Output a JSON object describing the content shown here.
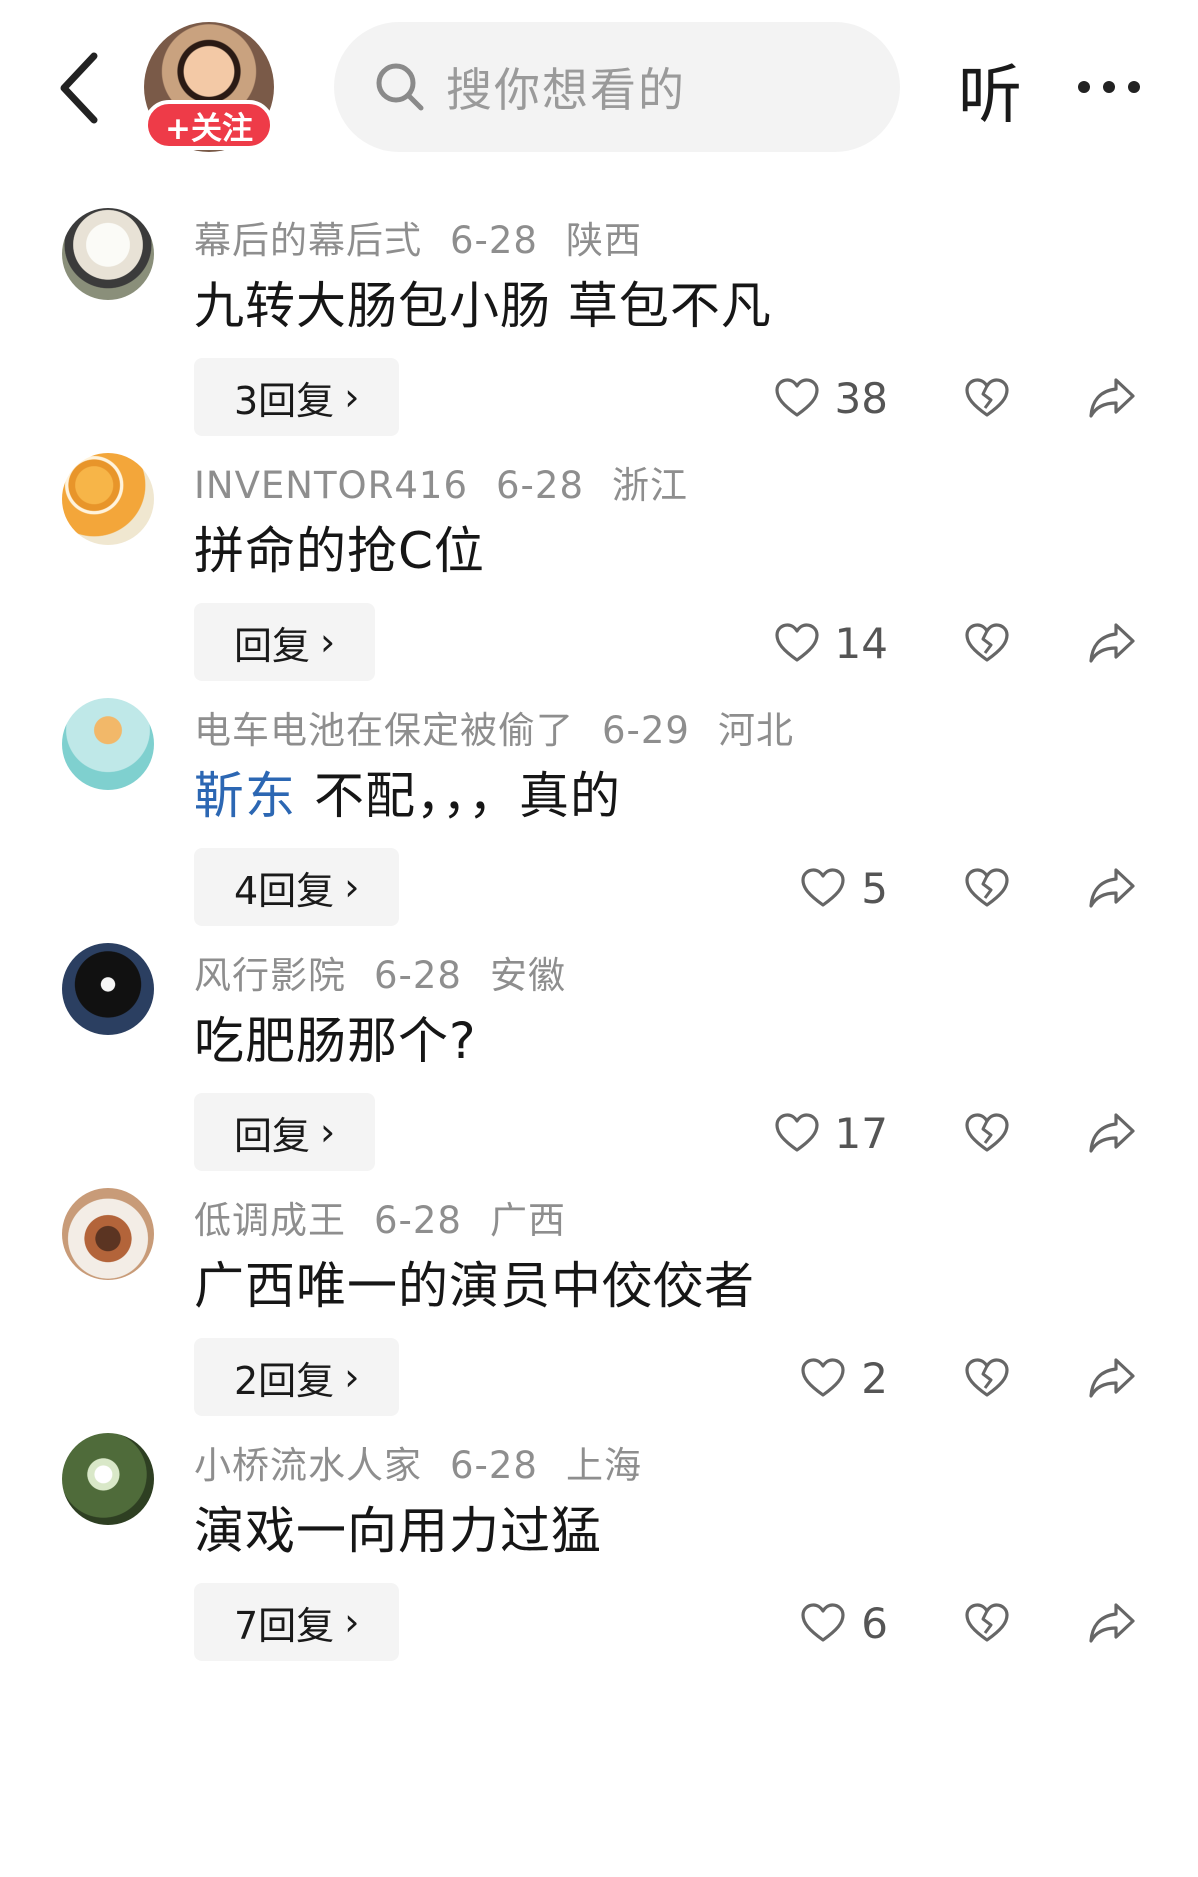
{
  "header": {
    "follow_label": "+关注",
    "search_placeholder": "搜你想看的",
    "listen_label": "听"
  },
  "comments": [
    {
      "user": "幕后的幕后弍",
      "date": "6-28",
      "region": "陕西",
      "text": "九转大肠包小肠 草包不凡",
      "mention": "",
      "reply_label": "3回复",
      "likes": "38",
      "avatar": "dog-avatar"
    },
    {
      "user": "INVENTOR416",
      "date": "6-28",
      "region": "浙江",
      "text": "拼命的抢C位",
      "mention": "",
      "reply_label": "回复",
      "likes": "14",
      "avatar": "loquat-avatar"
    },
    {
      "user": "电车电池在保定被偷了",
      "date": "6-29",
      "region": "河北",
      "text": "不配，，，真的",
      "mention": "靳东",
      "reply_label": "4回复",
      "likes": "5",
      "avatar": "cartoon-cat-avatar"
    },
    {
      "user": "风行影院",
      "date": "6-28",
      "region": "安徽",
      "text": "吃肥肠那个?",
      "mention": "",
      "reply_label": "回复",
      "likes": "17",
      "avatar": "hooded-figure-avatar"
    },
    {
      "user": "低调成王",
      "date": "6-28",
      "region": "广西",
      "text": "广西唯一的演员中佼佼者",
      "mention": "",
      "reply_label": "2回复",
      "likes": "2",
      "avatar": "food-bowl-avatar"
    },
    {
      "user": "小桥流水人家",
      "date": "6-28",
      "region": "上海",
      "text": "演戏一向用力过猛",
      "mention": "",
      "reply_label": "7回复",
      "likes": "6",
      "avatar": "flowers-avatar"
    }
  ],
  "colors": {
    "follow_badge": "#ee3b48",
    "mention": "#2c67b3",
    "meta_text": "#8e8e8e",
    "reply_bg": "#f4f4f4"
  },
  "icons": [
    "back-arrow-icon",
    "search-icon",
    "more-dots-icon",
    "heart-icon",
    "broken-heart-icon",
    "share-arrow-icon"
  ]
}
